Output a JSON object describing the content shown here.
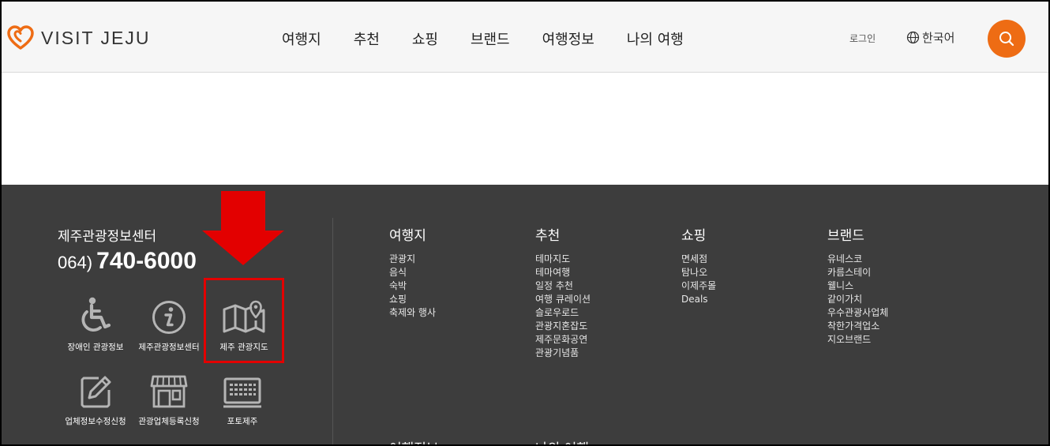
{
  "header": {
    "logo_text": "VISIT JEJU",
    "nav": [
      "여행지",
      "추천",
      "쇼핑",
      "브랜드",
      "여행정보",
      "나의 여행"
    ],
    "login": "로그인",
    "language": "한국어",
    "colors": {
      "accent": "#ee6c14",
      "background": "#f6f6f6"
    }
  },
  "footer": {
    "center": {
      "title": "제주관광정보센터",
      "phone_area": "064)",
      "phone_number": "740-6000"
    },
    "icons": [
      {
        "label": "장애인 관광정보",
        "icon": "wheelchair-icon"
      },
      {
        "label": "제주관광정보센터",
        "icon": "info-icon"
      },
      {
        "label": "제주 관광지도",
        "icon": "map-pin-icon"
      },
      {
        "label": "업체정보수정신청",
        "icon": "edit-icon"
      },
      {
        "label": "관광업체등록신청",
        "icon": "store-icon"
      },
      {
        "label": "포토제주",
        "icon": "keyboard-icon"
      }
    ],
    "columns": [
      {
        "title": "여행지",
        "links": [
          "관광지",
          "음식",
          "숙박",
          "쇼핑",
          "축제와 행사"
        ]
      },
      {
        "title": "추천",
        "links": [
          "테마지도",
          "테마여행",
          "일정 추천",
          "여행 큐레이션",
          "슬로우로드",
          "관광지혼잡도",
          "제주문화공연",
          "관광기념품"
        ]
      },
      {
        "title": "쇼핑",
        "links": [
          "면세점",
          "탐나오",
          "이제주몰",
          "Deals"
        ]
      },
      {
        "title": "브랜드",
        "links": [
          "유네스코",
          "카름스테이",
          "웰니스",
          "같이가치",
          "우수관광사업체",
          "착한가격업소",
          "지오브랜드"
        ]
      }
    ],
    "next_titles": [
      "여행정보",
      "나의 여행"
    ],
    "colors": {
      "background": "#3d3d3d"
    }
  },
  "annotation": {
    "color": "#e30000"
  }
}
